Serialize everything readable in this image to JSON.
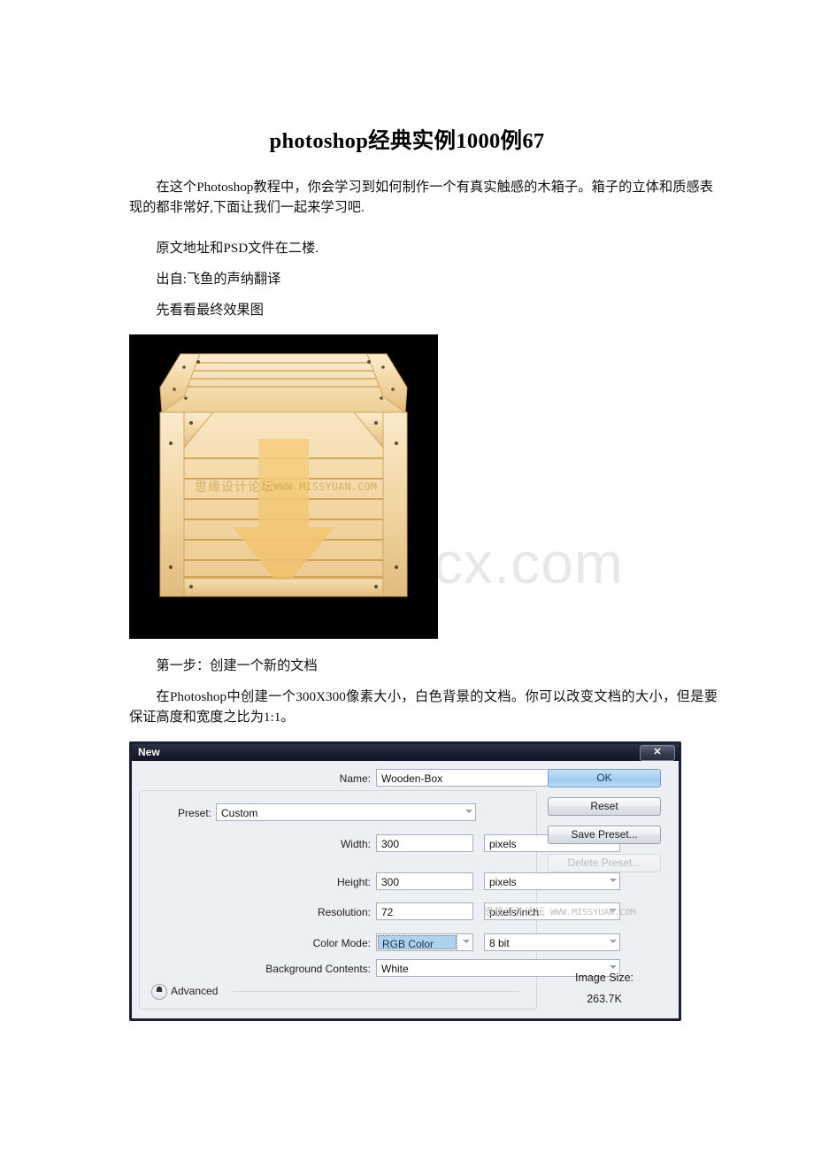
{
  "document": {
    "title": "photoshop经典实例1000例67",
    "paragraphs": {
      "intro": "在这个Photoshop教程中，你会学习到如何制作一个有真实触感的木箱子。箱子的立体和质感表现的都非常好,下面让我们一起来学习吧.",
      "source_1": "原文地址和PSD文件在二楼.",
      "source_2": "出自:飞鱼的声纳翻译",
      "preview_caption": "先看看最终效果图",
      "step1_heading": "第一步：创建一个新的文档",
      "step1_body": "在Photoshop中创建一个300X300像素大小，白色背景的文档。你可以改变文档的大小，但是要保证高度和宽度之比为1:1。"
    },
    "watermark": "www.bdocx.com"
  },
  "crate_figure": {
    "alt": "wooden-crate-with-down-arrow",
    "background_color": "#000000",
    "wood_light": "#f7dfb4",
    "wood_mid": "#f0cf96",
    "wood_dark": "#c79a45",
    "arrow_color": "#f2c96f",
    "watermark_cn": "思缘设计论坛",
    "watermark_url": "WWW.MISSYUAN.COM"
  },
  "ps_dialog": {
    "title": "New",
    "close_label": "✕",
    "watermark_cn": "思缘设计论坛",
    "watermark_url": "WWW.MISSYUAN.COM",
    "fields": {
      "name_label": "Name:",
      "name_value": "Wooden-Box",
      "preset_label": "Preset:",
      "preset_value": "Custom",
      "width_label": "Width:",
      "width_value": "300",
      "width_unit": "pixels",
      "height_label": "Height:",
      "height_value": "300",
      "height_unit": "pixels",
      "resolution_label": "Resolution:",
      "resolution_value": "72",
      "resolution_unit": "pixels/inch",
      "color_mode_label": "Color Mode:",
      "color_mode_value": "RGB Color",
      "color_depth_value": "8 bit",
      "background_contents_label": "Background Contents:",
      "background_contents_value": "White"
    },
    "buttons": {
      "ok": "OK",
      "reset": "Reset",
      "save_preset": "Save Preset...",
      "delete_preset": "Delete Preset..."
    },
    "advanced": {
      "label": "Advanced",
      "chevron_icon": "chevron-double-down"
    },
    "image_size": {
      "label": "Image Size:",
      "value": "263.7K"
    }
  }
}
